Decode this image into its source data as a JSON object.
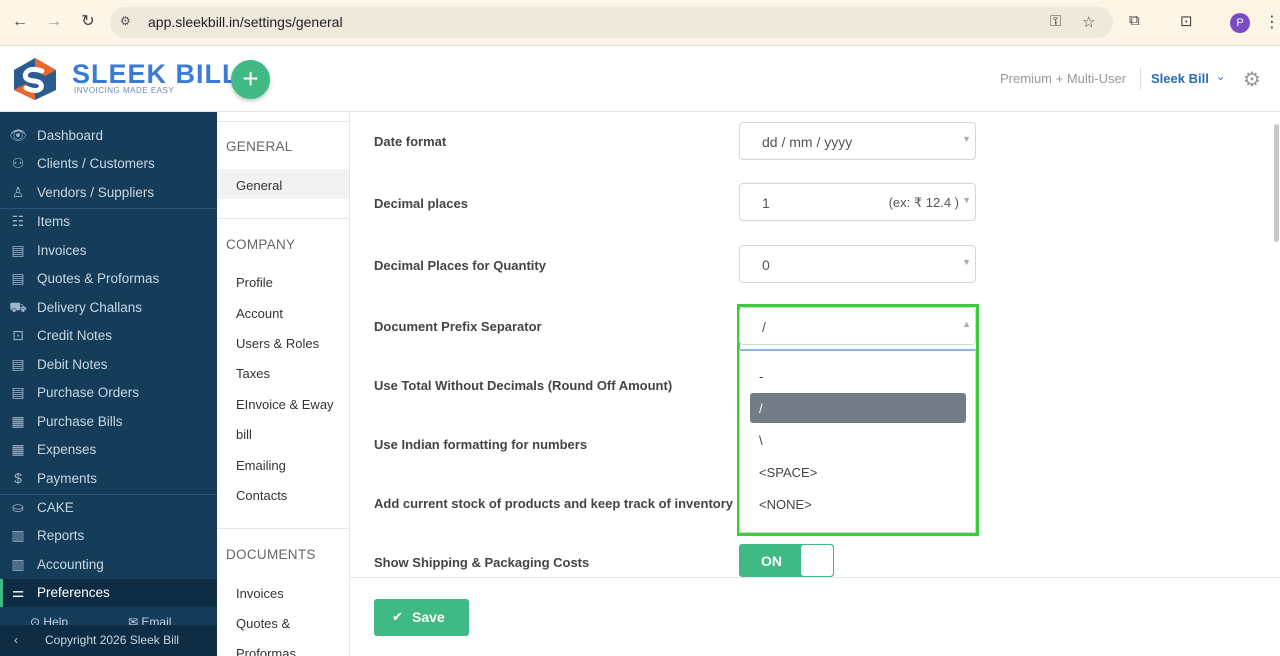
{
  "browser": {
    "url": "app.sleekbill.in/settings/general",
    "profile_initial": "P"
  },
  "header": {
    "logo_text": "SLEEK BILL",
    "logo_tagline": "INVOICING MADE EASY",
    "add_label": "+",
    "plan": "Premium + Multi-User",
    "company": "Sleek Bill"
  },
  "nav": {
    "items": [
      {
        "label": "Dashboard",
        "icon": "eye-icon"
      },
      {
        "label": "Clients / Customers",
        "icon": "users-icon"
      },
      {
        "label": "Vendors / Suppliers",
        "icon": "vendor-icon"
      },
      {
        "label": "Items",
        "icon": "basket-icon"
      },
      {
        "label": "Invoices",
        "icon": "invoice-icon"
      },
      {
        "label": "Quotes & Proformas",
        "icon": "quote-icon"
      },
      {
        "label": "Delivery Challans",
        "icon": "truck-icon"
      },
      {
        "label": "Credit Notes",
        "icon": "credit-note-icon"
      },
      {
        "label": "Debit Notes",
        "icon": "debit-note-icon"
      },
      {
        "label": "Purchase Orders",
        "icon": "purchase-order-icon"
      },
      {
        "label": "Purchase Bills",
        "icon": "purchase-bill-icon"
      },
      {
        "label": "Expenses",
        "icon": "calculator-icon"
      },
      {
        "label": "Payments",
        "icon": "dollar-icon"
      },
      {
        "label": "CAKE",
        "icon": "cake-icon"
      },
      {
        "label": "Reports",
        "icon": "reports-icon"
      },
      {
        "label": "Accounting",
        "icon": "accounting-icon"
      },
      {
        "label": "Preferences",
        "icon": "sliders-icon"
      }
    ],
    "help": "Help",
    "email": "Email",
    "copyright": "Copyright 2026 Sleek Bill"
  },
  "submenu": {
    "general_title": "GENERAL",
    "general_items": [
      "General"
    ],
    "company_title": "COMPANY",
    "company_items": [
      "Profile",
      "Account",
      "Users & Roles",
      "Taxes",
      "EInvoice & Eway",
      "bill",
      "Emailing",
      "Contacts"
    ],
    "documents_title": "DOCUMENTS",
    "documents_items": [
      "Invoices",
      "Quotes &",
      "Proformas"
    ]
  },
  "form": {
    "date_format_label": "Date format",
    "date_format_value": "dd / mm / yyyy",
    "decimal_places_label": "Decimal places",
    "decimal_places_value": "1",
    "decimal_places_hint": "(ex: ₹ 12.4 )",
    "decimal_qty_label": "Decimal Places for Quantity",
    "decimal_qty_value": "0",
    "prefix_sep_label": "Document Prefix Separator",
    "prefix_sep_value": "/",
    "prefix_sep_options": [
      "-",
      "/",
      "\\",
      "<SPACE>",
      "<NONE>"
    ],
    "round_off_label": "Use Total Without Decimals (Round Off Amount)",
    "indian_format_label": "Use Indian formatting for numbers",
    "stock_label": "Add current stock of products and keep track of inventory",
    "shipping_label": "Show Shipping & Packaging Costs",
    "shipping_toggle": "ON"
  },
  "actions": {
    "save": "Save"
  },
  "colors": {
    "accent": "#3fba85",
    "nav_bg": "#153d5a",
    "highlight": "#3bcb3b",
    "selected_option": "#727c87"
  }
}
